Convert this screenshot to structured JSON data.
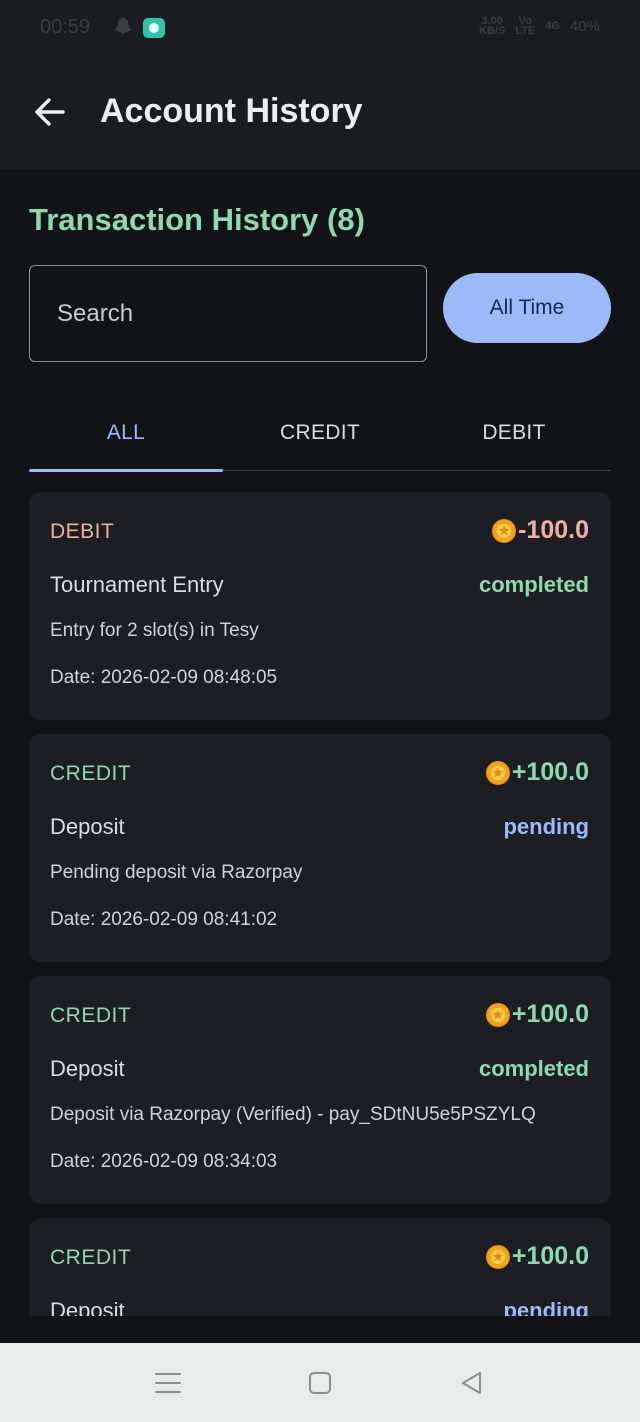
{
  "status_bar": {
    "time": "00:59",
    "net_speed_value": "3.00",
    "net_speed_unit": "KB/S",
    "volte_top": "Vo",
    "volte_bottom": "LTE",
    "signal": "4G",
    "battery": "40%"
  },
  "app_bar": {
    "title": "Account History",
    "back_icon": "arrow-left-icon"
  },
  "transactions_header": {
    "title": "Transaction History (8)"
  },
  "search": {
    "placeholder": "Search",
    "value": ""
  },
  "time_filter": {
    "label": "All Time"
  },
  "tabs": [
    {
      "label": "ALL",
      "active": true
    },
    {
      "label": "CREDIT",
      "active": false
    },
    {
      "label": "DEBIT",
      "active": false
    }
  ],
  "transactions": [
    {
      "type": "DEBIT",
      "amount": "-100.0",
      "category": "Tournament Entry",
      "status": "completed",
      "description": "Entry for 2 slot(s) in Tesy",
      "date": "Date: 2026-02-09 08:48:05"
    },
    {
      "type": "CREDIT",
      "amount": "+100.0",
      "category": "Deposit",
      "status": "pending",
      "description": "Pending deposit via Razorpay",
      "date": "Date: 2026-02-09 08:41:02"
    },
    {
      "type": "CREDIT",
      "amount": "+100.0",
      "category": "Deposit",
      "status": "completed",
      "description": "Deposit via Razorpay (Verified) - pay_SDtNU5e5PSZYLQ",
      "date": "Date: 2026-02-09 08:34:03"
    },
    {
      "type": "CREDIT",
      "amount": "+100.0",
      "category": "Deposit",
      "status": "pending",
      "description": "",
      "date": ""
    }
  ],
  "colors": {
    "background": "#111317",
    "card": "#1c1e23",
    "credit": "#8fd8b0",
    "debit": "#f2b0a2",
    "accent": "#9cbaf9"
  },
  "nav_bar": {
    "icons": [
      "menu-icon",
      "home-square-icon",
      "back-triangle-icon"
    ]
  }
}
